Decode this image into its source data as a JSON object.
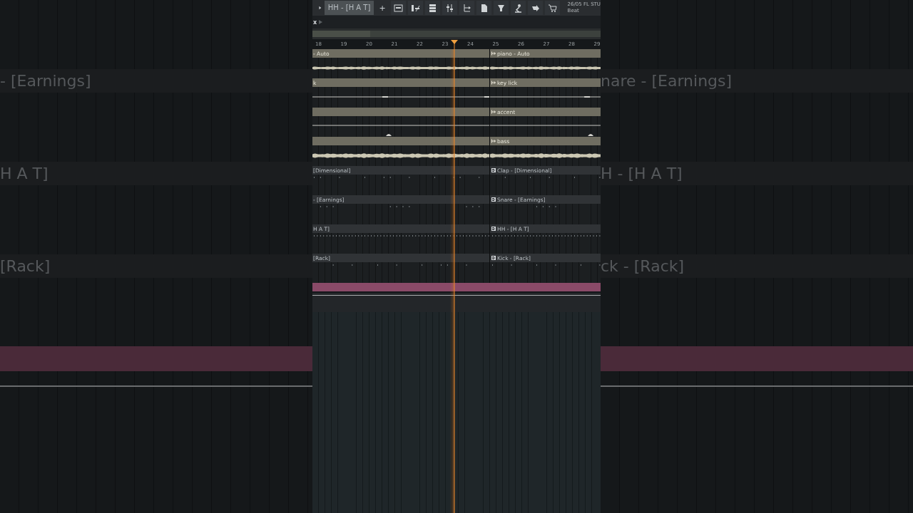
{
  "backdrop": {
    "left": [
      "- [Earnings]",
      "H A T]",
      "[Rack]"
    ],
    "right": [
      "nare - [Earnings]",
      "H - [H A T]",
      "ck - [Rack]"
    ]
  },
  "toolbar": {
    "pattern": "HH - [H A T]",
    "add": "+",
    "info": [
      "26/05 FL STU",
      "Beat"
    ]
  },
  "breadcrumb": {
    "label": "x"
  },
  "ruler": {
    "bars": [
      "18",
      "19",
      "20",
      "21",
      "22",
      "23",
      "24",
      "25",
      "26",
      "27",
      "28",
      "29"
    ]
  },
  "tracks": [
    {
      "kind": "waveform",
      "left_label": "- Auto",
      "label": "piano - Auto"
    },
    {
      "kind": "automation",
      "left_label": "k",
      "label": "key lick"
    },
    {
      "kind": "automation",
      "label": "accent"
    },
    {
      "kind": "waveform",
      "label": "bass"
    },
    {
      "kind": "pattern",
      "left_label": "[Dimensional]",
      "label": "Clap - [Dimensional]"
    },
    {
      "kind": "pattern",
      "left_label": "- [Earnings]",
      "label": "Snare - [Earnings]"
    },
    {
      "kind": "pattern",
      "left_label": "H  A  T]",
      "label": "HH - [H  A  T]"
    },
    {
      "kind": "pattern",
      "left_label": "[Rack]",
      "label": "Kick - [Rack]"
    },
    {
      "kind": "band"
    }
  ]
}
